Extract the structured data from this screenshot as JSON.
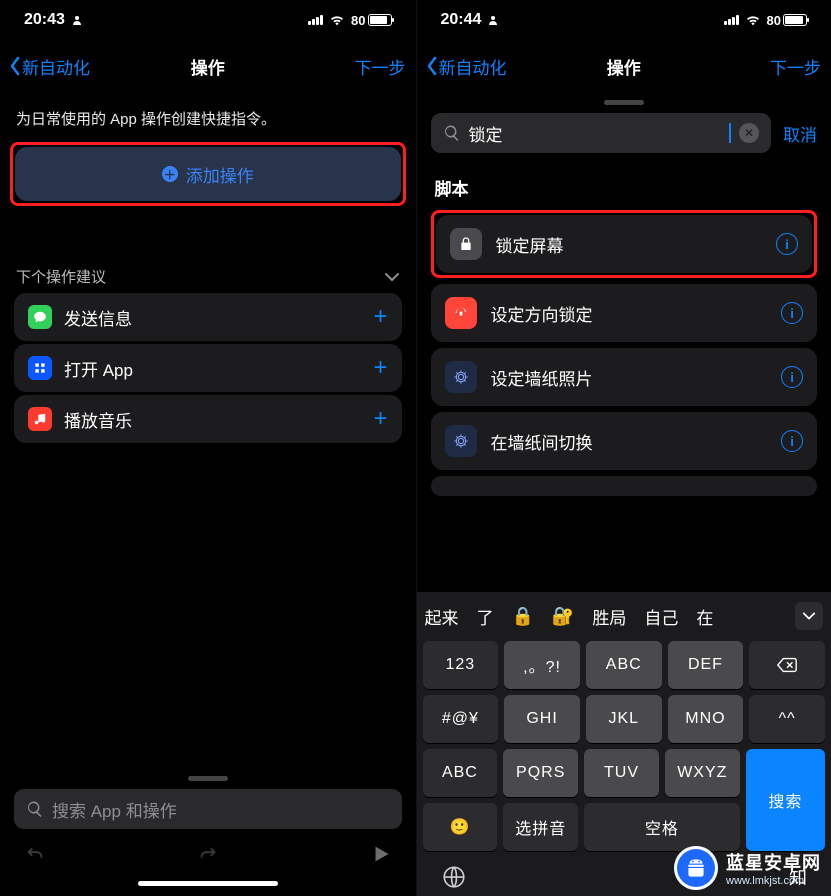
{
  "left": {
    "status": {
      "time": "20:43",
      "battery": "80"
    },
    "nav": {
      "back": "新自动化",
      "title": "操作",
      "next": "下一步"
    },
    "helper": "为日常使用的 App 操作创建快捷指令。",
    "add_action": "添加操作",
    "suggestion_header": "下个操作建议",
    "suggestions": [
      {
        "label": "发送信息"
      },
      {
        "label": "打开 App"
      },
      {
        "label": "播放音乐"
      }
    ],
    "search_placeholder": "搜索 App 和操作"
  },
  "right": {
    "status": {
      "time": "20:44",
      "battery": "80"
    },
    "nav": {
      "back": "新自动化",
      "title": "操作",
      "next": "下一步"
    },
    "search_value": "锁定",
    "cancel": "取消",
    "section": "脚本",
    "results": [
      {
        "label": "锁定屏幕"
      },
      {
        "label": "设定方向锁定"
      },
      {
        "label": "设定墙纸照片"
      },
      {
        "label": "在墙纸间切换"
      }
    ],
    "keyboard": {
      "candidates": [
        "起来",
        "了",
        "🔒",
        "🔐",
        "胜局",
        "自己",
        "在"
      ],
      "row1": [
        "123",
        ",。?!",
        "ABC",
        "DEF"
      ],
      "row2": [
        "#@¥",
        "GHI",
        "JKL",
        "MNO",
        "^^"
      ],
      "row3": [
        "ABC",
        "PQRS",
        "TUV",
        "WXYZ"
      ],
      "search": "搜索",
      "select_pinyin": "选拼音",
      "space": "空格",
      "backspace": "⌫",
      "zhi": "知"
    }
  },
  "watermark": {
    "title": "蓝星安卓网",
    "url": "www.lmkjst.com"
  }
}
